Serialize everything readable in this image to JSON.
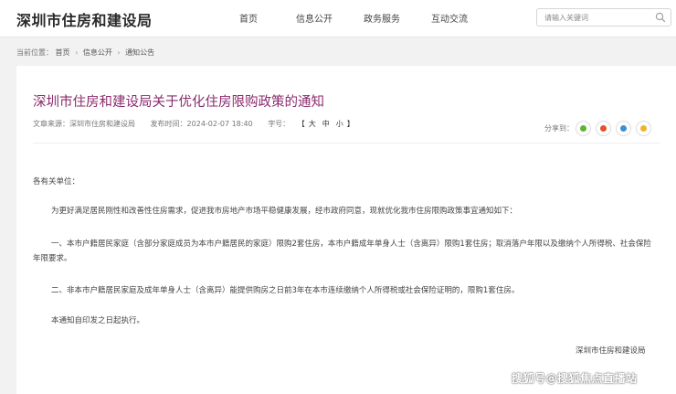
{
  "header": {
    "logo": "深圳市住房和建设局",
    "nav": [
      "首页",
      "信息公开",
      "政务服务",
      "互动交流"
    ],
    "search_placeholder": "请输入关键词"
  },
  "breadcrumb": {
    "prefix": "当前位置：",
    "items": [
      "首页",
      "信息公开",
      "通知公告"
    ]
  },
  "article": {
    "title": "深圳市住房和建设局关于优化住房限购政策的通知",
    "source": "文章来源：深圳市住房和建设局",
    "time": "发布时间：2024-02-07 18:40",
    "font_label": "字号：",
    "font_sizes": [
      "大",
      "中",
      "小"
    ],
    "share_label": "分享到：",
    "share_icons": [
      "wechat-icon",
      "weibo-icon",
      "qq-icon",
      "qzone-icon"
    ],
    "greeting": "各有关单位：",
    "intro": "为更好满足居民刚性和改善性住房需求，促进我市房地产市场平稳健康发展，经市政府同意，现就优化我市住房限购政策事宜通知如下：",
    "item1": "一、本市户籍居民家庭（含部分家庭成员为本市户籍居民的家庭）限购2套住房，本市户籍成年单身人士（含离异）限购1套住房；取消落户年限以及缴纳个人所得税、社会保险年限要求。",
    "item2": "二、非本市户籍居民家庭及成年单身人士（含离异）能提供购房之日前3年在本市连续缴纳个人所得税或社会保险证明的，限购1套住房。",
    "effective": "本通知自印发之日起执行。",
    "signature": "深圳市住房和建设局"
  },
  "watermark": "搜狐号@搜狐焦点直播站",
  "colors": {
    "title": "#8a2b6d",
    "share_wechat": "#5cb531",
    "share_weibo": "#e6502a",
    "share_qq": "#3a8fd8",
    "share_qzone": "#f0b429"
  }
}
